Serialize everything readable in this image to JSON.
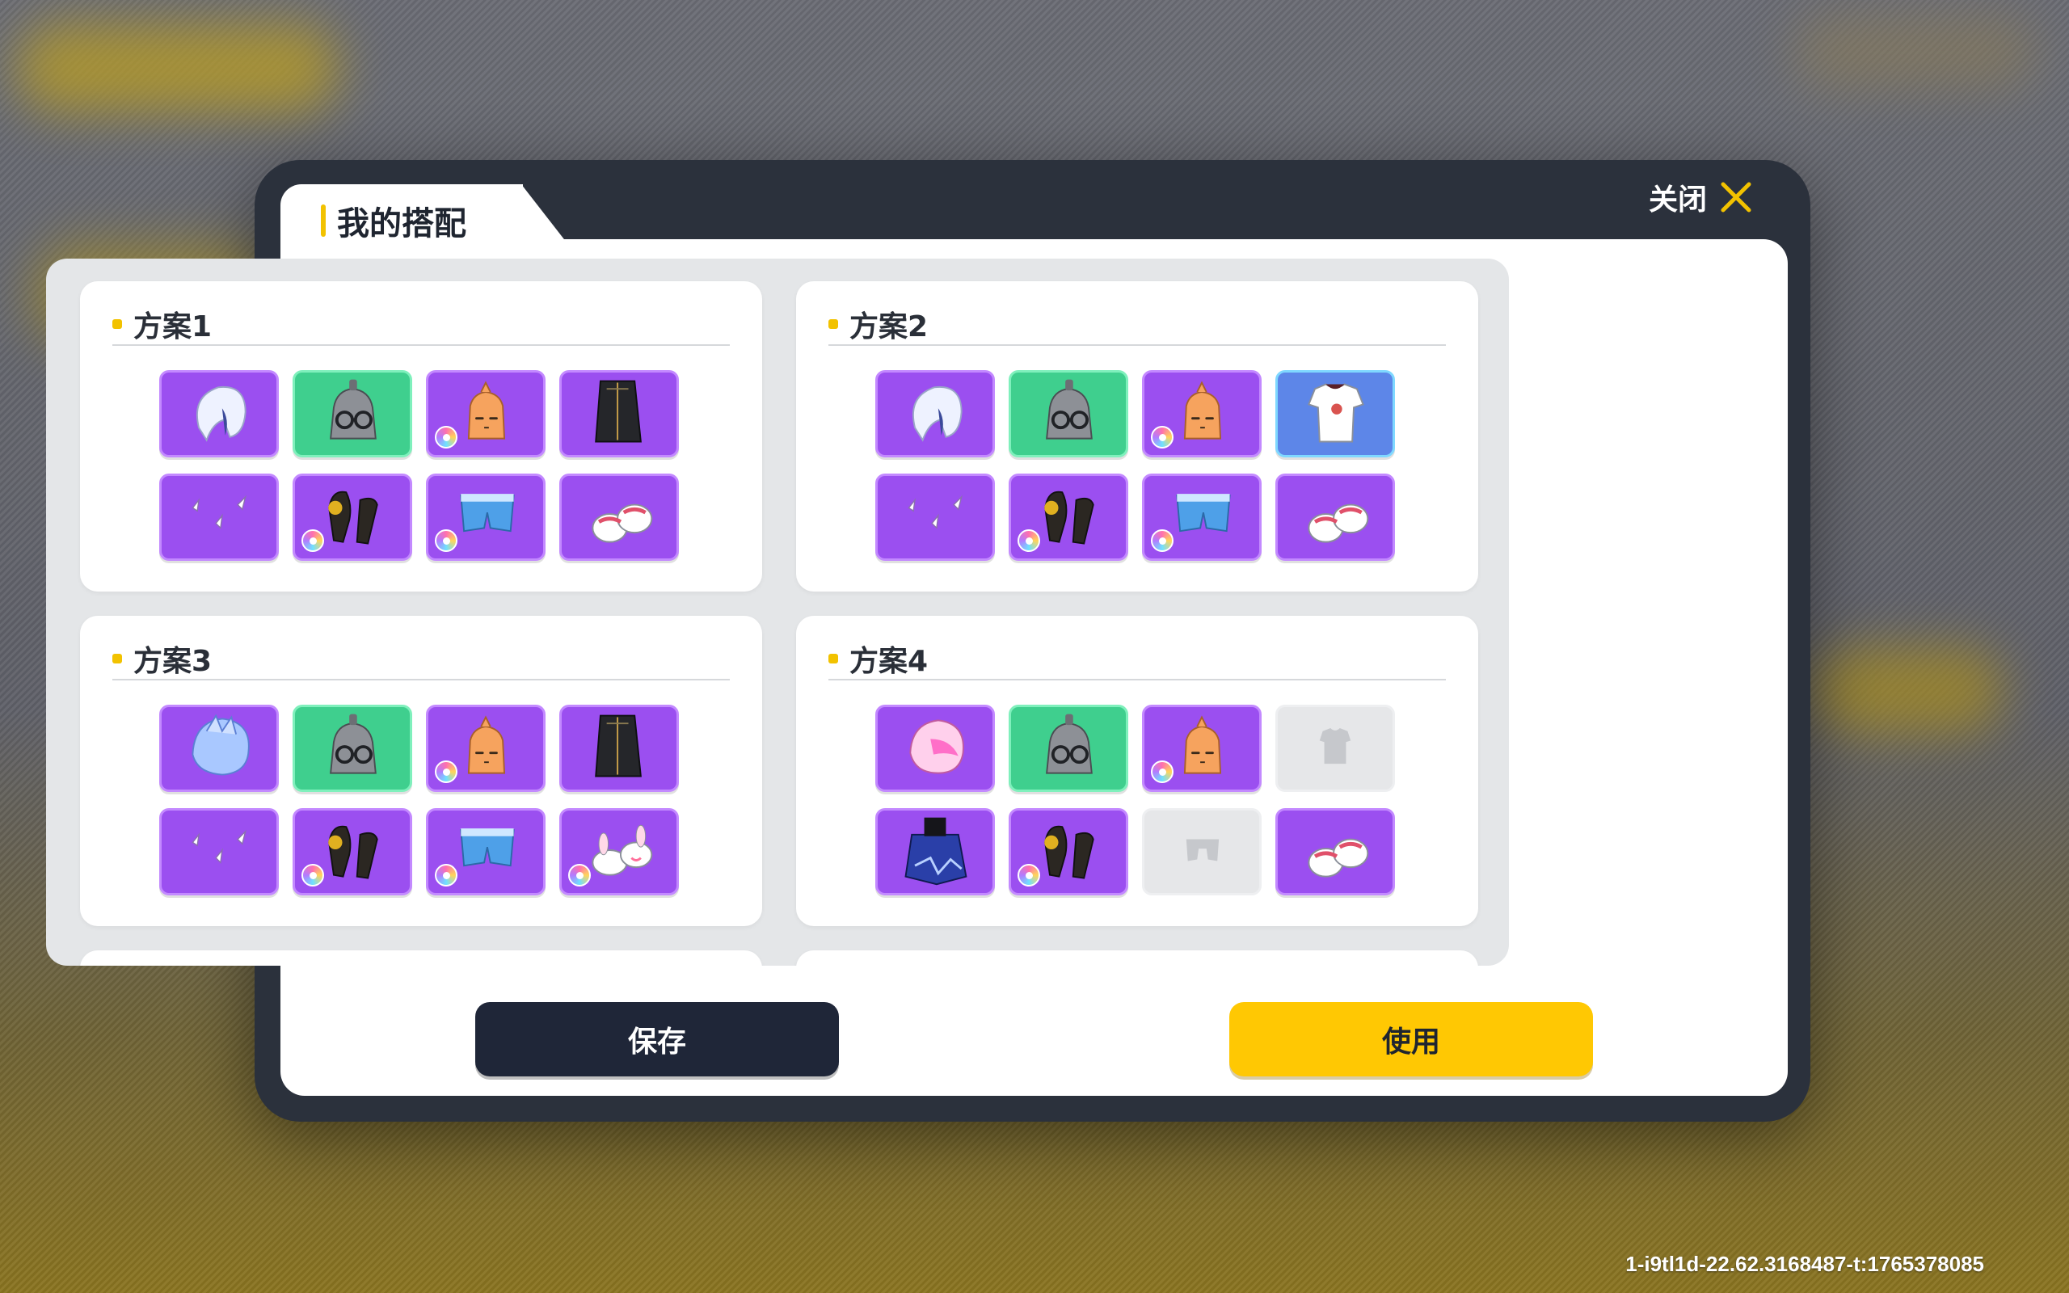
{
  "dialog": {
    "title": "我的搭配",
    "close_label": "关闭"
  },
  "outfits": [
    {
      "name": "方案1",
      "slots": [
        {
          "item": "white-hair-icon",
          "rarity": "purple",
          "badge": false
        },
        {
          "item": "helmet-glasses-icon",
          "rarity": "green",
          "badge": false
        },
        {
          "item": "orange-mask-icon",
          "rarity": "purple",
          "badge": true
        },
        {
          "item": "black-coat-icon",
          "rarity": "purple",
          "badge": false
        },
        {
          "item": "feathers-icon",
          "rarity": "purple",
          "badge": false
        },
        {
          "item": "dark-gloves-icon",
          "rarity": "purple",
          "badge": true
        },
        {
          "item": "blue-shorts-icon",
          "rarity": "purple",
          "badge": true
        },
        {
          "item": "white-shoes-icon",
          "rarity": "purple",
          "badge": false
        }
      ]
    },
    {
      "name": "方案2",
      "slots": [
        {
          "item": "white-hair-icon",
          "rarity": "purple",
          "badge": false
        },
        {
          "item": "helmet-glasses-icon",
          "rarity": "green",
          "badge": false
        },
        {
          "item": "orange-mask-icon",
          "rarity": "purple",
          "badge": true
        },
        {
          "item": "white-tshirt-icon",
          "rarity": "blue",
          "badge": false
        },
        {
          "item": "feathers-icon",
          "rarity": "purple",
          "badge": false
        },
        {
          "item": "dark-gloves-icon",
          "rarity": "purple",
          "badge": true
        },
        {
          "item": "blue-shorts-icon",
          "rarity": "purple",
          "badge": true
        },
        {
          "item": "white-shoes-icon",
          "rarity": "purple",
          "badge": false
        }
      ]
    },
    {
      "name": "方案3",
      "slots": [
        {
          "item": "blue-hair-icon",
          "rarity": "purple",
          "badge": false
        },
        {
          "item": "helmet-glasses-icon",
          "rarity": "green",
          "badge": false
        },
        {
          "item": "orange-mask-icon",
          "rarity": "purple",
          "badge": true
        },
        {
          "item": "black-coat-icon",
          "rarity": "purple",
          "badge": false
        },
        {
          "item": "feathers-icon",
          "rarity": "purple",
          "badge": false
        },
        {
          "item": "dark-gloves-icon",
          "rarity": "purple",
          "badge": true
        },
        {
          "item": "blue-shorts-icon",
          "rarity": "purple",
          "badge": true
        },
        {
          "item": "bunny-slippers-icon",
          "rarity": "purple",
          "badge": true
        }
      ]
    },
    {
      "name": "方案4",
      "slots": [
        {
          "item": "pink-hair-icon",
          "rarity": "purple",
          "badge": false
        },
        {
          "item": "helmet-glasses-icon",
          "rarity": "green",
          "badge": false
        },
        {
          "item": "orange-mask-icon",
          "rarity": "purple",
          "badge": true
        },
        {
          "item": "empty-top-icon",
          "rarity": "empty",
          "badge": false
        },
        {
          "item": "blue-cape-icon",
          "rarity": "purple",
          "badge": false
        },
        {
          "item": "dark-gloves-icon",
          "rarity": "purple",
          "badge": true
        },
        {
          "item": "empty-bottom-icon",
          "rarity": "empty",
          "badge": false
        },
        {
          "item": "white-shoes-icon",
          "rarity": "purple",
          "badge": false
        }
      ]
    }
  ],
  "buttons": {
    "save_label": "保存",
    "use_label": "使用"
  },
  "footer": {
    "build_id": "1-i9tl1d-22.62.3168487-t:1765378085"
  }
}
